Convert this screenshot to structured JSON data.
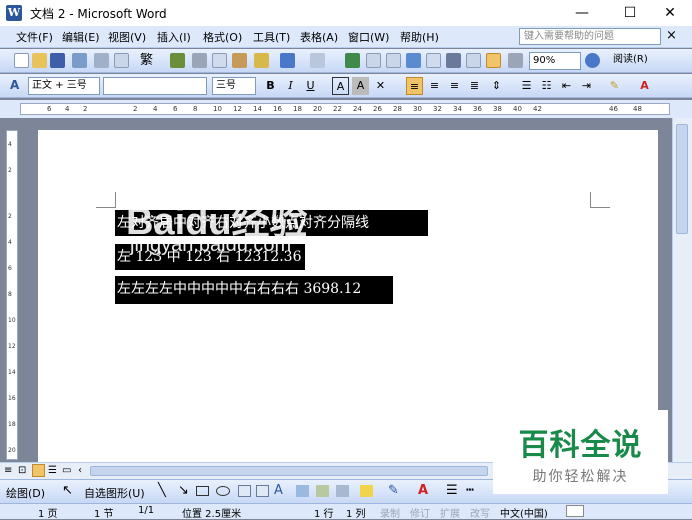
{
  "window": {
    "title": "文档 2 - Microsoft Word",
    "app_icon": "W",
    "min": "—",
    "max": "☐",
    "close": "✕"
  },
  "menu": [
    "文件(F)",
    "编辑(E)",
    "视图(V)",
    "插入(I)",
    "格式(O)",
    "工具(T)",
    "表格(A)",
    "窗口(W)",
    "帮助(H)"
  ],
  "help_box": {
    "placeholder": "键入需要帮助的问题",
    "close": "×"
  },
  "standard_toolbar": {
    "zoom": "90%",
    "read_label": "阅读(R)"
  },
  "format_toolbar": {
    "style": "正文 + 三号",
    "font": "",
    "size": "三号",
    "bold": "B",
    "italic": "I",
    "underline": "U",
    "charbox": "A",
    "shade": "A"
  },
  "ruler": {
    "marks": [
      "6",
      "4",
      "2",
      "2",
      "4",
      "6",
      "8",
      "10",
      "12",
      "14",
      "16",
      "18",
      "20",
      "22",
      "24",
      "26",
      "28",
      "30",
      "32",
      "34",
      "36",
      "38",
      "40",
      "42",
      "46",
      "48"
    ],
    "vmarks": [
      "4",
      "2",
      "2",
      "4",
      "6",
      "8",
      "10",
      "12",
      "14",
      "16",
      "18",
      "20"
    ]
  },
  "document": {
    "lines": [
      "左对齐居中对齐右对齐小数点对齐分隔线",
      "左 123  中 123  右 12312.36",
      "左左左左中中中中中右右右右 3698.12"
    ]
  },
  "watermark": {
    "logo": "Baidu经验",
    "url": "jingyan.baidu.com"
  },
  "overlay": {
    "title": "百科全说",
    "subtitle": "助你轻松解决"
  },
  "draw_toolbar": {
    "draw": "绘图(D)",
    "autoshape": "自选图形(U)"
  },
  "status": {
    "page": "1 页",
    "section": "1 节",
    "pages": "1/1",
    "position": "位置 2.5厘米",
    "line": "1 行",
    "column": "1 列",
    "rec": "录制",
    "trk": "修订",
    "ext": "扩展",
    "ovr": "改写",
    "lang": "中文(中国)"
  },
  "colors": {
    "accent": "#2b579a",
    "toolbar": "#dde9fb",
    "highlight": "#000000",
    "overlay_green": "#1a8a4a"
  }
}
